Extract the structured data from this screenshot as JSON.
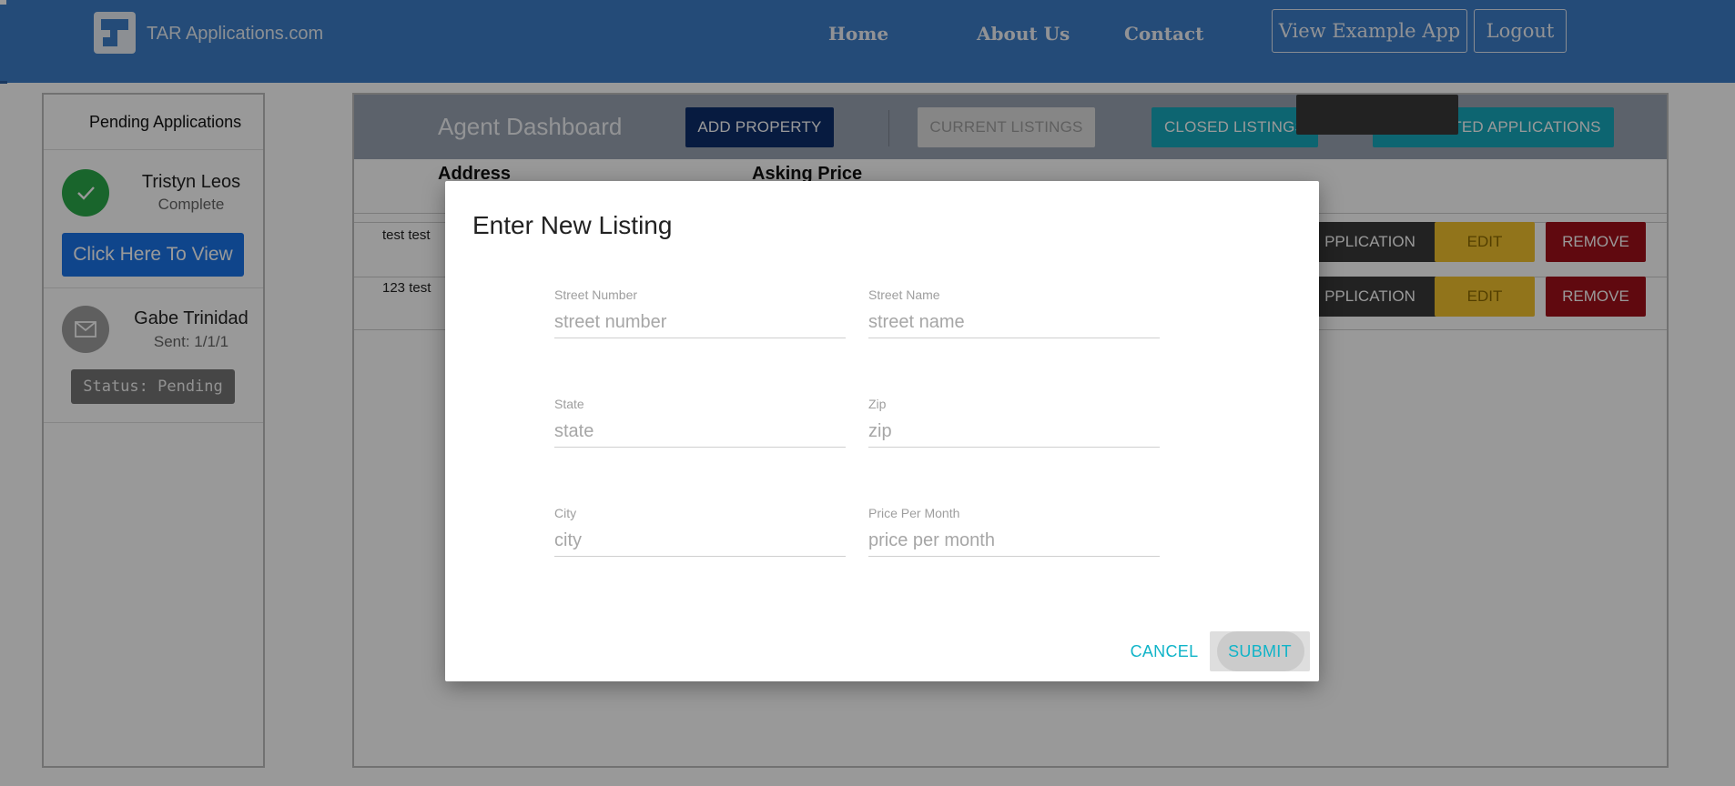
{
  "navbar": {
    "brand": "TAR Applications.com",
    "links": [
      "Home",
      "About Us",
      "Contact"
    ],
    "buttons": [
      "View Example App",
      "Logout"
    ]
  },
  "sidebar": {
    "title": "Pending Applications",
    "applicants": [
      {
        "name": "Tristyn Leos",
        "subtext": "Complete",
        "action": "Click Here To View",
        "icon": "check-icon"
      },
      {
        "name": "Gabe Trinidad",
        "subtext": "Sent: 1/1/1",
        "status": "Status: Pending",
        "icon": "mail-icon"
      }
    ]
  },
  "dashboard": {
    "title": "Agent Dashboard",
    "buttons": [
      "ADD PROPERTY",
      "CURRENT LISTINGS",
      "CLOSED LISTINGS",
      "COMPLETED APPLICATIONS"
    ],
    "columns": [
      "Address",
      "Asking Price"
    ],
    "rows": [
      {
        "address": "test test",
        "actions": [
          "PPLICATION",
          "EDIT",
          "REMOVE"
        ]
      },
      {
        "address": "123 test",
        "actions": [
          "PPLICATION",
          "EDIT",
          "REMOVE"
        ]
      }
    ]
  },
  "modal": {
    "title": "Enter New Listing",
    "fields": [
      {
        "label": "Street Number",
        "placeholder": "street number",
        "value": ""
      },
      {
        "label": "Street Name",
        "placeholder": "street name",
        "value": ""
      },
      {
        "label": "State",
        "placeholder": "state",
        "value": ""
      },
      {
        "label": "Zip",
        "placeholder": "zip",
        "value": ""
      },
      {
        "label": "City",
        "placeholder": "city",
        "value": ""
      },
      {
        "label": "Price Per Month",
        "placeholder": "price per month",
        "value": ""
      }
    ],
    "cancel": "CANCEL",
    "submit": "SUBMIT"
  },
  "colors": {
    "navbar": "#3d7ec8",
    "add_property": "#0d2d6b",
    "teal": "#17a9bd",
    "edit": "#f2c12e",
    "remove": "#a00f1a",
    "application": "#3a3a3a",
    "accent_text": "#10b4c8"
  }
}
